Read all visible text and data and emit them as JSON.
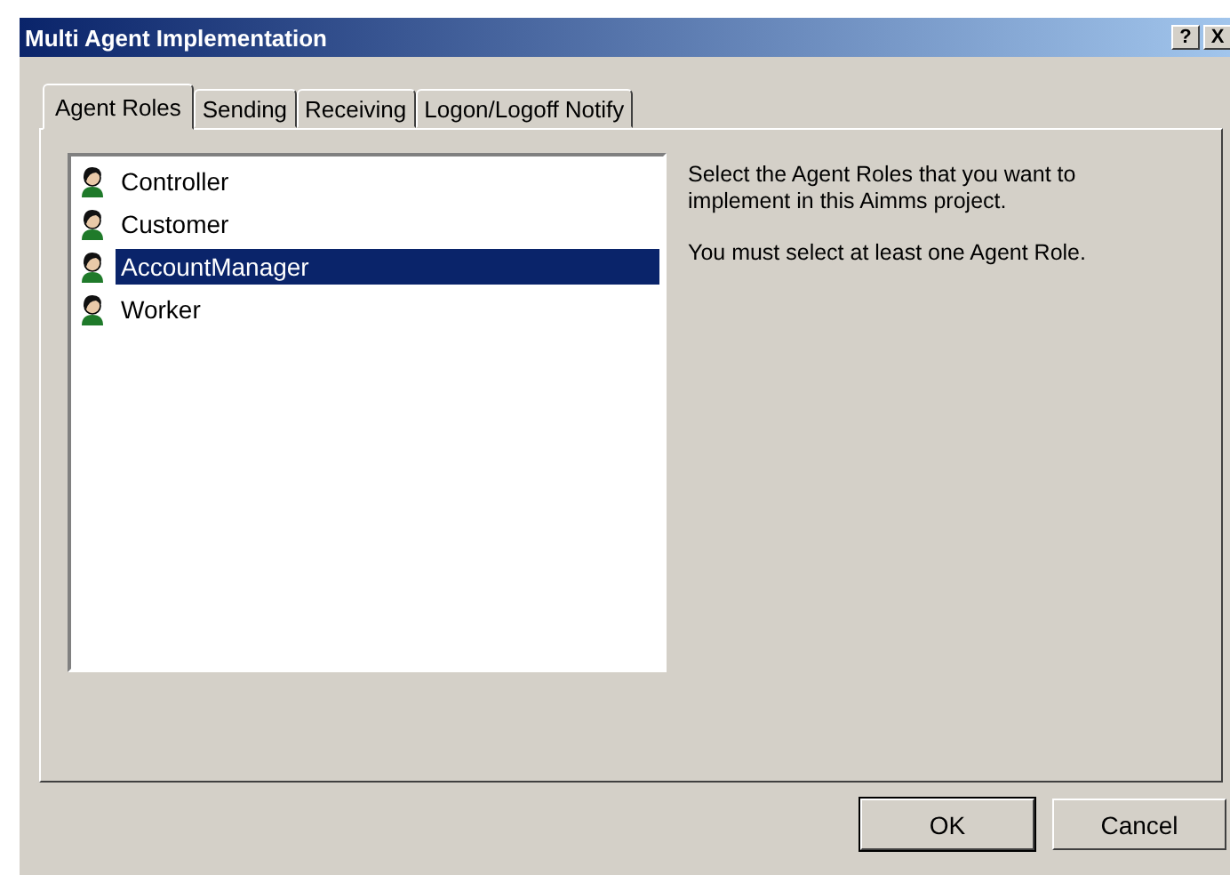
{
  "window": {
    "title": "Multi Agent Implementation",
    "title_buttons": [
      "?",
      "X"
    ]
  },
  "tabs": [
    {
      "label": "Agent Roles",
      "selected": true
    },
    {
      "label": "Sending",
      "selected": false
    },
    {
      "label": "Receiving",
      "selected": false
    },
    {
      "label": "Logon/Logoff Notify",
      "selected": false
    }
  ],
  "roles": [
    {
      "label": "Controller",
      "selected": false
    },
    {
      "label": "Customer",
      "selected": false
    },
    {
      "label": "AccountManager",
      "selected": true
    },
    {
      "label": "Worker",
      "selected": false
    }
  ],
  "help_texts": [
    "Select the Agent Roles that you want to implement in this Aimms project.",
    "You must select at least one Agent Role."
  ],
  "buttons": [
    {
      "label": "OK",
      "default": true
    },
    {
      "label": "Cancel",
      "default": false
    }
  ]
}
